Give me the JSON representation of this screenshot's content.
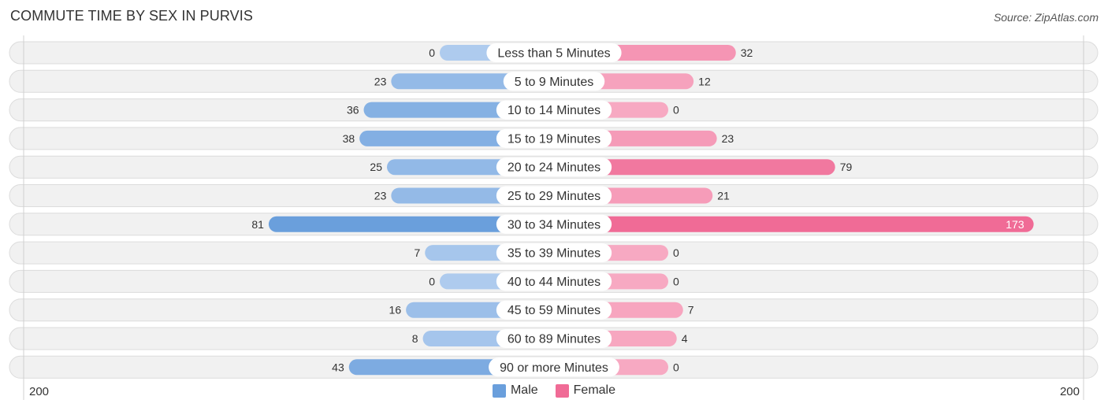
{
  "header": {
    "title": "COMMUTE TIME BY SEX IN PURVIS",
    "source": "Source: ZipAtlas.com"
  },
  "colors": {
    "male_strong": "#6a9fdc",
    "male_light": "#aecbee",
    "female_strong": "#f06b96",
    "female_light": "#f7a9c2",
    "row_bg": "#f1f1f1",
    "row_border": "#dcdcdc"
  },
  "chart_data": {
    "type": "bar",
    "orientation": "horizontal-diverging",
    "title": "COMMUTE TIME BY SEX IN PURVIS",
    "categories": [
      "Less than 5 Minutes",
      "5 to 9 Minutes",
      "10 to 14 Minutes",
      "15 to 19 Minutes",
      "20 to 24 Minutes",
      "25 to 29 Minutes",
      "30 to 34 Minutes",
      "35 to 39 Minutes",
      "40 to 44 Minutes",
      "45 to 59 Minutes",
      "60 to 89 Minutes",
      "90 or more Minutes"
    ],
    "series": [
      {
        "name": "Male",
        "values": [
          0,
          23,
          36,
          38,
          25,
          23,
          81,
          7,
          0,
          16,
          8,
          43
        ]
      },
      {
        "name": "Female",
        "values": [
          32,
          12,
          0,
          23,
          79,
          21,
          173,
          0,
          0,
          7,
          4,
          0
        ]
      }
    ],
    "axis_min_label": "200",
    "axis_max_label": "200",
    "xlim": [
      -200,
      200
    ],
    "legend": [
      "Male",
      "Female"
    ],
    "legend_position": "bottom-center"
  }
}
